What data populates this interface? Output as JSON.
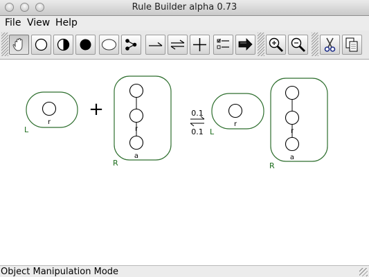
{
  "window": {
    "title": "Rule Builder alpha 0.73"
  },
  "menu": {
    "file": "File",
    "view": "View",
    "help": "Help"
  },
  "toolbar": {
    "tools": [
      {
        "name": "hand-tool",
        "icon": "hand-icon",
        "pressed": true
      },
      {
        "name": "site-empty-tool",
        "icon": "empty-circle-icon"
      },
      {
        "name": "site-half-tool",
        "icon": "half-filled-circle-icon"
      },
      {
        "name": "site-filled-tool",
        "icon": "filled-circle-icon"
      },
      {
        "name": "molecule-tool",
        "icon": "ellipse-icon"
      },
      {
        "name": "branch-tool",
        "icon": "branch-nodes-icon"
      },
      {
        "name": "forward-arrow-tool",
        "icon": "right-arrow-icon"
      },
      {
        "name": "reversible-arrow-tool",
        "icon": "reversible-arrow-icon"
      },
      {
        "name": "plus-tool",
        "icon": "plus-icon"
      },
      {
        "name": "checklist-tool",
        "icon": "checklist-icon"
      },
      {
        "name": "export-tool",
        "icon": "export-arrow-icon"
      },
      {
        "name": "zoom-in-tool",
        "icon": "zoom-in-icon"
      },
      {
        "name": "zoom-out-tool",
        "icon": "zoom-out-icon"
      },
      {
        "name": "cut-tool",
        "icon": "scissors-icon"
      },
      {
        "name": "copy-tool",
        "icon": "copy-icon"
      }
    ]
  },
  "rule": {
    "reactants": [
      {
        "label": "L",
        "sites": [
          "r"
        ]
      },
      {
        "label": "R",
        "sites": [
          "l",
          "r",
          "a"
        ]
      }
    ],
    "operator": "+",
    "arrow": "reversible-arrow",
    "forward_rate": "0.1",
    "reverse_rate": "0.1",
    "products": [
      {
        "label": "L",
        "sites": [
          "r"
        ]
      },
      {
        "label": "R",
        "sites": [
          "l",
          "r",
          "a"
        ]
      }
    ]
  },
  "colors": {
    "molecule_outline": "#2d6e2d",
    "molecule_label": "#1a6b1a"
  },
  "status": {
    "text": "Object Manipulation Mode"
  }
}
